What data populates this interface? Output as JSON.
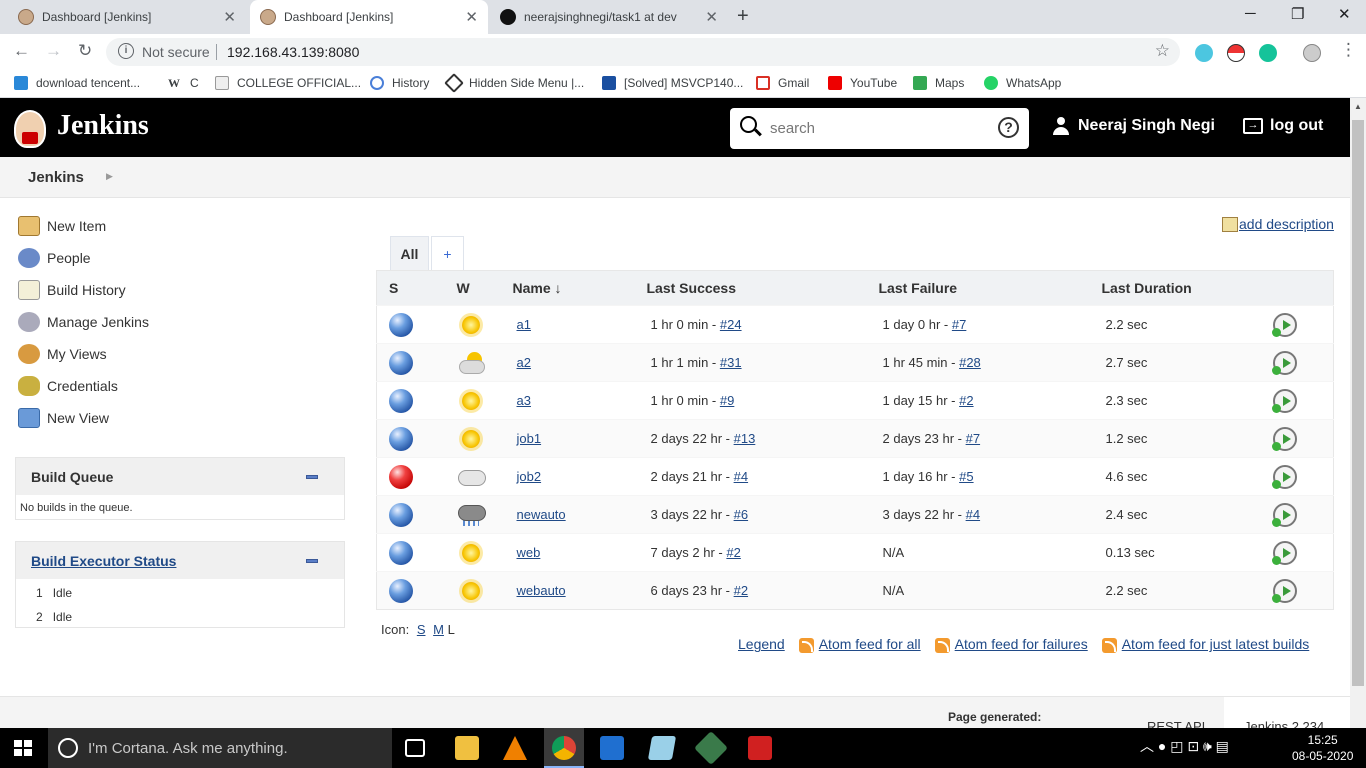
{
  "browser": {
    "tabs": [
      {
        "title": "Dashboard [Jenkins]",
        "active": false
      },
      {
        "title": "Dashboard [Jenkins]",
        "active": true
      },
      {
        "title": "neerajsinghnegi/task1 at dev",
        "active": false
      }
    ],
    "new_tab": "+",
    "security_label": "Not secure",
    "url": "192.168.43.139:8080",
    "bookmarks": [
      "download tencent...",
      "C",
      "COLLEGE OFFICIAL...",
      "History",
      "Hidden Side Menu |...",
      "[Solved] MSVCP140...",
      "Gmail",
      "YouTube",
      "Maps",
      "WhatsApp"
    ]
  },
  "header": {
    "brand": "Jenkins",
    "search_placeholder": "search",
    "help": "?",
    "user": "Neeraj Singh Negi",
    "logout": "log out"
  },
  "breadcrumb": {
    "root": "Jenkins"
  },
  "side_panel": {
    "tasks": [
      "New Item",
      "People",
      "Build History",
      "Manage Jenkins",
      "My Views",
      "Credentials",
      "New View"
    ],
    "build_queue": {
      "title": "Build Queue",
      "empty_text": "No builds in the queue."
    },
    "executors": {
      "title": "Build Executor Status",
      "rows": [
        {
          "num": "1",
          "state": "Idle"
        },
        {
          "num": "2",
          "state": "Idle"
        }
      ]
    }
  },
  "main": {
    "add_description": "add description",
    "view_tabs": {
      "all": "All",
      "add": "+"
    },
    "columns": {
      "s": "S",
      "w": "W",
      "name": "Name ↓",
      "last_success": "Last Success",
      "last_failure": "Last Failure",
      "last_duration": "Last Duration"
    },
    "jobs": [
      {
        "status": "blue",
        "weather": "sunny",
        "name": "a1",
        "ls_time": "1 hr 0 min - ",
        "ls_build": "#24",
        "lf_time": "1 day 0 hr - ",
        "lf_build": "#7",
        "duration": "2.2 sec"
      },
      {
        "status": "blue",
        "weather": "partly",
        "name": "a2",
        "ls_time": "1 hr 1 min - ",
        "ls_build": "#31",
        "lf_time": "1 hr 45 min - ",
        "lf_build": "#28",
        "duration": "2.7 sec"
      },
      {
        "status": "blue",
        "weather": "sunny",
        "name": "a3",
        "ls_time": "1 hr 0 min - ",
        "ls_build": "#9",
        "lf_time": "1 day 15 hr - ",
        "lf_build": "#2",
        "duration": "2.3 sec"
      },
      {
        "status": "blue",
        "weather": "sunny",
        "name": "job1",
        "ls_time": "2 days 22 hr - ",
        "ls_build": "#13",
        "lf_time": "2 days 23 hr - ",
        "lf_build": "#7",
        "duration": "1.2 sec"
      },
      {
        "status": "red",
        "weather": "cloudy",
        "name": "job2",
        "ls_time": "2 days 21 hr - ",
        "ls_build": "#4",
        "lf_time": "1 day 16 hr - ",
        "lf_build": "#5",
        "duration": "4.6 sec"
      },
      {
        "status": "blue",
        "weather": "storm",
        "name": "newauto",
        "ls_time": "3 days 22 hr - ",
        "ls_build": "#6",
        "lf_time": "3 days 22 hr - ",
        "lf_build": "#4",
        "duration": "2.4 sec"
      },
      {
        "status": "blue",
        "weather": "sunny",
        "name": "web",
        "ls_time": "7 days 2 hr - ",
        "ls_build": "#2",
        "lf_time": "N/A",
        "lf_build": "",
        "duration": "0.13 sec"
      },
      {
        "status": "blue",
        "weather": "sunny",
        "name": "webauto",
        "ls_time": "6 days 23 hr - ",
        "ls_build": "#2",
        "lf_time": "N/A",
        "lf_build": "",
        "duration": "2.2 sec"
      }
    ],
    "icon_size": {
      "label": "Icon:",
      "s": "S",
      "m": "M",
      "l": "L"
    },
    "feeds": {
      "legend": "Legend",
      "all": "Atom feed for all",
      "failures": "Atom feed for failures",
      "latest": "Atom feed for just latest builds"
    }
  },
  "footer": {
    "generated": "Page generated:",
    "rest_api": "REST API",
    "version": "Jenkins 2.234"
  },
  "taskbar": {
    "cortana": "I'm Cortana. Ask me anything.",
    "time": "15:25",
    "date": "08-05-2020"
  }
}
